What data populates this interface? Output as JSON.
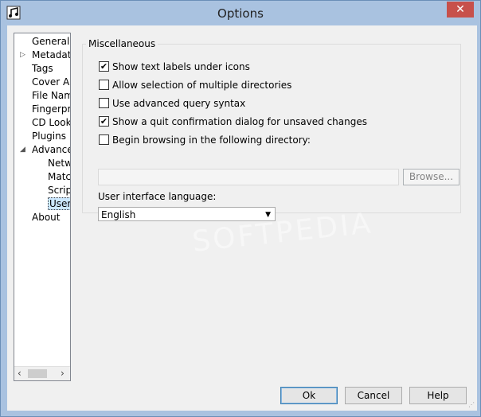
{
  "window": {
    "title": "Options",
    "close_glyph": "✕"
  },
  "tree": {
    "items": [
      {
        "label": "General",
        "indent": 0,
        "expander": ""
      },
      {
        "label": "Metadata",
        "indent": 0,
        "expander": "▷"
      },
      {
        "label": "Tags",
        "indent": 0,
        "expander": ""
      },
      {
        "label": "Cover Art",
        "indent": 0,
        "expander": ""
      },
      {
        "label": "File Naming",
        "indent": 0,
        "expander": ""
      },
      {
        "label": "Fingerprinting",
        "indent": 0,
        "expander": ""
      },
      {
        "label": "CD Lookup",
        "indent": 0,
        "expander": ""
      },
      {
        "label": "Plugins",
        "indent": 0,
        "expander": ""
      },
      {
        "label": "Advanced",
        "indent": 0,
        "expander": "◢"
      },
      {
        "label": "Network",
        "indent": 1,
        "expander": ""
      },
      {
        "label": "Matching",
        "indent": 1,
        "expander": ""
      },
      {
        "label": "Scripting",
        "indent": 1,
        "expander": ""
      },
      {
        "label": "User Interface",
        "indent": 1,
        "expander": "",
        "selected": true
      },
      {
        "label": "About",
        "indent": 0,
        "expander": ""
      }
    ]
  },
  "misc": {
    "title": "Miscellaneous",
    "options": [
      {
        "label": "Show text labels under icons",
        "checked": true
      },
      {
        "label": "Allow selection of multiple directories",
        "checked": false
      },
      {
        "label": "Use advanced query syntax",
        "checked": false
      },
      {
        "label": "Show a quit confirmation dialog for unsaved changes",
        "checked": true
      },
      {
        "label": "Begin browsing in the following directory:",
        "checked": false
      }
    ],
    "directory_value": "",
    "browse_label": "Browse...",
    "language_label": "User interface language:",
    "language_value": "English"
  },
  "buttons": {
    "ok": "Ok",
    "cancel": "Cancel",
    "help": "Help"
  },
  "watermark": "SOFTPEDIA"
}
